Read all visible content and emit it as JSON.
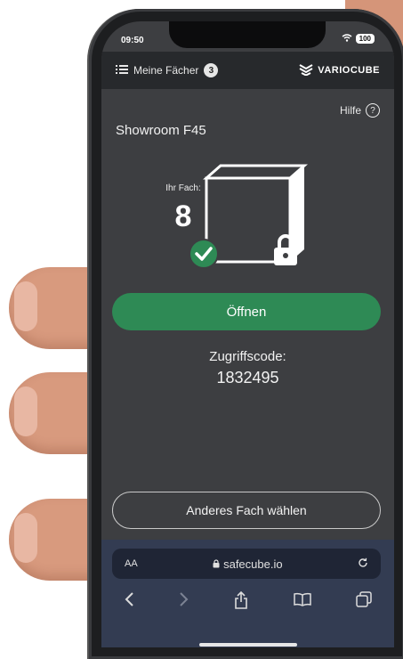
{
  "status": {
    "time": "09:50",
    "battery": "100"
  },
  "header": {
    "menu_label": "Meine Fächer",
    "badge_count": "3",
    "brand": "VARIOCUBE"
  },
  "help": {
    "label": "Hilfe",
    "icon": "question-icon"
  },
  "location": "Showroom F45",
  "locker": {
    "caption": "Ihr Fach:",
    "number": "8"
  },
  "actions": {
    "open_label": "Öffnen",
    "other_label": "Anderes Fach wählen"
  },
  "access": {
    "label": "Zugriffscode:",
    "code": "1832495"
  },
  "browser": {
    "text_size": "AA",
    "url": "safecube.io"
  },
  "colors": {
    "accent": "#2e8a55",
    "screen_bg": "#3d3e41",
    "topbar_bg": "#27292c",
    "browser_bg": "#333c52"
  }
}
